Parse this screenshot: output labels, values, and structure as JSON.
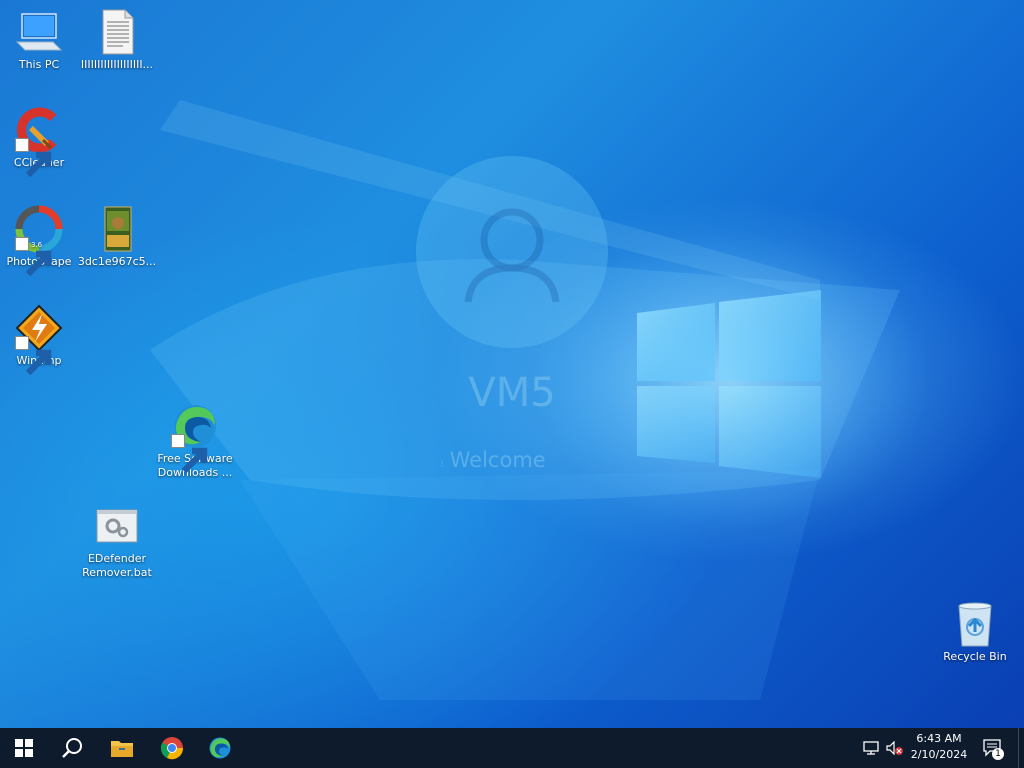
{
  "wallpaper": {
    "user_name": "VM5",
    "welcome_text": "Welcome"
  },
  "desktop_icons": [
    {
      "name": "this-pc",
      "label": "This PC"
    },
    {
      "name": "text-file",
      "label": "IIIIIIIIIIIIIIIIIII..."
    },
    {
      "name": "ccleaner",
      "label": "CCleaner"
    },
    {
      "name": "photoscape",
      "label": "PhotoScape"
    },
    {
      "name": "image-file",
      "label": "3dc1e967c5..."
    },
    {
      "name": "winamp",
      "label": "Winamp"
    },
    {
      "name": "free-software-downloads",
      "label": "Free Software Downloads ..."
    },
    {
      "name": "edefender-remover",
      "label": "EDefender Remover.bat"
    },
    {
      "name": "recycle-bin",
      "label": "Recycle Bin"
    }
  ],
  "taskbar": {
    "buttons": [
      "windows-start-icon",
      "search-icon",
      "file-explorer-icon",
      "chrome-icon",
      "edge-icon"
    ],
    "tray_icons": [
      "network-icon",
      "volume-muted-icon"
    ],
    "time": "6:43 AM",
    "date": "2/10/2024",
    "notification_count": "1"
  },
  "colors": {
    "desktop_blue": "#1a78d4",
    "taskbar": "#0e1b2c",
    "accent": "#4fc3ff"
  }
}
